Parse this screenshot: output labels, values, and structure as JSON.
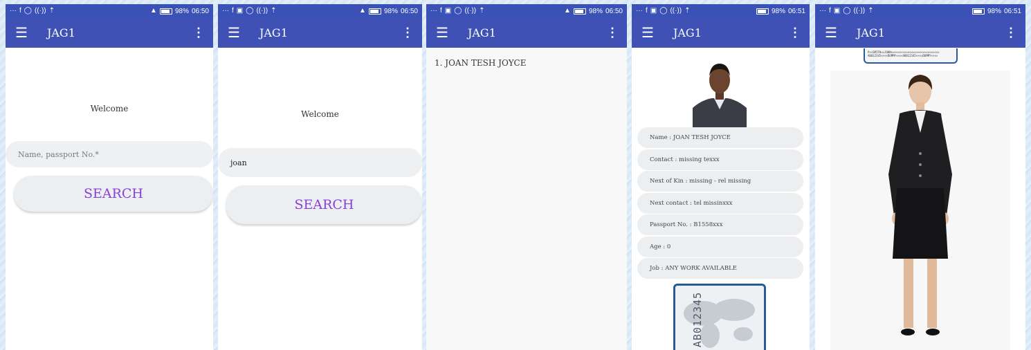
{
  "status_bar": [
    {
      "left": [
        "···",
        "f",
        "▣",
        "◯",
        "((·))",
        "⇡"
      ],
      "battery": "98%",
      "time": "06:50"
    },
    {
      "left": [
        "···",
        "f",
        "▣",
        "◯",
        "((·))",
        "⇡"
      ],
      "battery": "98%",
      "time": "06:50"
    },
    {
      "left": [
        "···",
        "f",
        "▣",
        "◯",
        "((·))",
        "⇡"
      ],
      "battery": "98%",
      "time": "06:50"
    },
    {
      "left": [
        "···",
        "f",
        "▣",
        "◯",
        "((·))",
        "⇡"
      ],
      "battery": "98%",
      "time": "06:51"
    },
    {
      "left": [
        "···",
        "f",
        "▣",
        "◯",
        "((·))",
        "⇡"
      ],
      "battery": "98%",
      "time": "06:51"
    }
  ],
  "app": {
    "title": "JAG1",
    "menu_icon": "hamburger-menu-icon",
    "overflow_icon": "more-vert-icon"
  },
  "screen1": {
    "welcome": "Welcome",
    "search_placeholder": "Name, passport No.*",
    "search_button": "SEARCH"
  },
  "screen2": {
    "welcome": "Welcome",
    "search_value": "joan",
    "search_button": "SEARCH"
  },
  "screen3": {
    "results": [
      "1. JOAN TESH JOYCE"
    ]
  },
  "screen4": {
    "details": [
      "Name : JOAN TESH JOYCE",
      "Contact : missing texxx",
      "Next of Kin : missing - rel missing",
      "Next contact : tel missinxxx",
      "Passport No. : B1558xxx",
      "Age : 0",
      "Job : ANY WORK AVAILABLE"
    ],
    "passport_number": "AB012345"
  },
  "screen5": {
    "mrz_line1": "P<<SMITH<<JOHN<<<<<<<<<<<<<<<<<<<<<<<<<<<<<",
    "mrz_line2": "AB012345<<<<DUMMY<<<<AB012345<<<<DUMMY<<<<"
  },
  "colors": {
    "appbar": "#3f51b5",
    "status": "#3a51b6",
    "accent": "#8a3fd6",
    "field": "#eef0f2"
  }
}
